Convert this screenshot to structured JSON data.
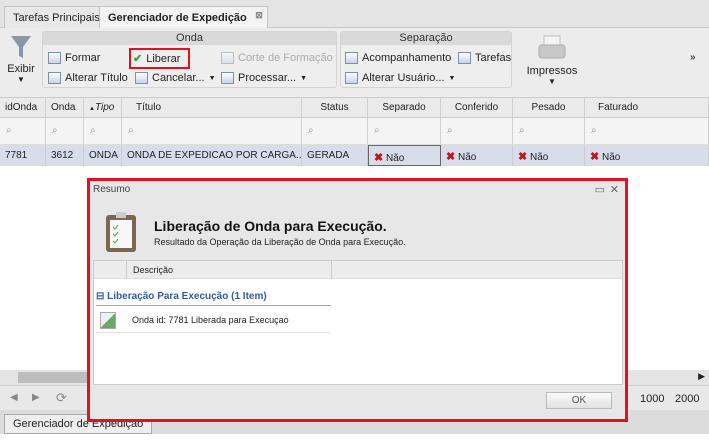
{
  "tabs": [
    {
      "label": "Tarefas Principais"
    },
    {
      "label": "Gerenciador de Expedição"
    }
  ],
  "toolbar": {
    "exibir": "Exibir",
    "onda": {
      "title": "Onda",
      "formar": "Formar",
      "liberar": "Liberar",
      "corte": "Corte de Formação",
      "alterar_titulo": "Alterar Título",
      "cancelar": "Cancelar...",
      "processar": "Processar..."
    },
    "separacao": {
      "title": "Separação",
      "acompanhamento": "Acompanhamento",
      "tarefas": "Tarefas",
      "alterar_usuario": "Alterar Usuário..."
    },
    "impressos": "Impressos",
    "more": "»"
  },
  "grid": {
    "columns": [
      "idOnda",
      "Onda",
      "Tipo",
      "Título",
      "Status",
      "Separado",
      "Conferido",
      "Pesado",
      "Faturado"
    ],
    "rows": [
      {
        "idOnda": "7781",
        "onda": "3612",
        "tipo": "ONDA",
        "titulo": "ONDA DE EXPEDICAO POR CARGA...",
        "status": "GERADA",
        "separado": "Não",
        "conferido": "Não",
        "pesado": "Não",
        "faturado": "Não"
      }
    ]
  },
  "paging": {
    "sizes": [
      "1000",
      "2000"
    ]
  },
  "bottom_tab": "Gerenciador de Expedição",
  "dialog": {
    "title": "Resumo",
    "heading": "Liberação de Onda para Execução.",
    "subheading": "Resultado da Operação da Liberação de Onda para Execução.",
    "column": "Descrição",
    "group": "Liberação Para Execução (1 Item)",
    "item": "Onda id: 7781 Liberada para Execuçao",
    "ok": "OK"
  }
}
